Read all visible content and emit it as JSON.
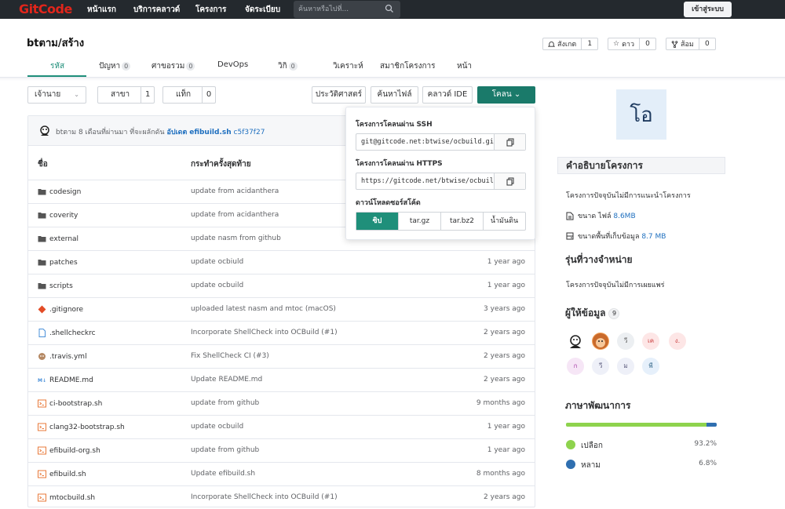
{
  "nav": {
    "logo": "GitCode",
    "items": [
      "หน้าแรก",
      "บริการคลาวด์",
      "โครงการ",
      "จัดระเบียบ"
    ],
    "search_placeholder": "ค้นหาหรือไปที่...",
    "login": "เข้าสู่ระบบ"
  },
  "repo": {
    "title": "btตาม/สร้าง",
    "watch": {
      "label": "สังเกต",
      "count": "1"
    },
    "star": {
      "label": "ดาว",
      "count": "0"
    },
    "fork": {
      "label": "ส้อม",
      "count": "0"
    }
  },
  "tabs": [
    {
      "label": "รหัส",
      "badge": ""
    },
    {
      "label": "ปัญหา",
      "badge": "0"
    },
    {
      "label": "ศาขอรวม",
      "badge": "0"
    },
    {
      "label": "DevOps",
      "badge": ""
    },
    {
      "label": "วิกิ",
      "badge": "0"
    },
    {
      "label": "วิเคราะห์",
      "badge": ""
    },
    {
      "label": "สมาชิกโครงการ",
      "badge": ""
    },
    {
      "label": "หน้า",
      "badge": ""
    }
  ],
  "toolbar": {
    "branch_select": "เจ้านาย",
    "branches": {
      "label": "สาขา",
      "count": "1"
    },
    "tags": {
      "label": "แท็ก",
      "count": "0"
    },
    "history": "ประวัติศาสตร์",
    "find_file": "ค้นหาไฟล์",
    "cloud_ide": "คลาวด์ IDE",
    "clone": "โคลน"
  },
  "commit": {
    "author": "btตาม",
    "when": "8 เดือนที่ผ่านมา",
    "action": "ที่จะผลักดัน",
    "update": "อัปเดต",
    "file": "efibuild.sh",
    "hash": "c5f37f27"
  },
  "table": {
    "col_name": "ชื่อ",
    "col_commit": "กระทำครั้งสุดท้าย",
    "rows": [
      {
        "icon": "folder-icon",
        "name": "codesign",
        "msg": "update from acidanthera",
        "time": ""
      },
      {
        "icon": "folder-icon",
        "name": "coverity",
        "msg": "update from acidanthera",
        "time": ""
      },
      {
        "icon": "folder-icon",
        "name": "external",
        "msg": "update nasm from github",
        "time": ""
      },
      {
        "icon": "folder-icon",
        "name": "patches",
        "msg": "update ocbiuld",
        "time": "1 year ago"
      },
      {
        "icon": "folder-icon",
        "name": "scripts",
        "msg": "update ocbuild",
        "time": "1 year ago"
      },
      {
        "icon": "git-icon",
        "name": ".gitignore",
        "msg": "uploaded latest nasm and mtoc (macOS)",
        "time": "3 years ago"
      },
      {
        "icon": "file-icon",
        "name": ".shellcheckrc",
        "msg": "Incorporate ShellCheck into OCBuild (#1)",
        "time": "2 years ago"
      },
      {
        "icon": "travis-icon",
        "name": ".travis.yml",
        "msg": "Fix ShellCheck CI (#3)",
        "time": "2 years ago"
      },
      {
        "icon": "markdown-icon",
        "name": "README.md",
        "msg": "Update README.md",
        "time": "2 years ago"
      },
      {
        "icon": "shell-icon",
        "name": "ci-bootstrap.sh",
        "msg": "update from github",
        "time": "9 months ago"
      },
      {
        "icon": "shell-icon",
        "name": "clang32-bootstrap.sh",
        "msg": "update ocbuild",
        "time": "1 year ago"
      },
      {
        "icon": "shell-icon",
        "name": "efibuild-org.sh",
        "msg": "update from github",
        "time": "1 year ago"
      },
      {
        "icon": "shell-icon",
        "name": "efibuild.sh",
        "msg": "Update efibuild.sh",
        "time": "8 months ago"
      },
      {
        "icon": "shell-icon",
        "name": "mtocbuild.sh",
        "msg": "Incorporate ShellCheck into OCBuild (#1)",
        "time": "2 years ago"
      }
    ]
  },
  "clone_popover": {
    "ssh_title": "โครงการโคลนผ่าน SSH",
    "ssh_url": "git@gitcode.net:btwise/ocbuild.git",
    "https_title": "โครงการโคลนผ่าน HTTPS",
    "https_url": "https://gitcode.net/btwise/ocbuild.git",
    "download_title": "ดาวน์โหลดซอร์สโค้ด",
    "downloads": [
      "ซิป",
      "tar.gz",
      "tar.bz2",
      "น้ำมันดิน"
    ]
  },
  "sidebar": {
    "avatar_letter": "โอ",
    "desc_title": "คำอธิบายโครงการ",
    "desc_text": "โครงการปัจจุบันไม่มีการแนะนำโครงการ",
    "file_size_label": "ขนาด ไฟล์",
    "file_size": "8.6MB",
    "storage_label": "ขนาดพื้นที่เก็บข้อมูล",
    "storage": "8.7 MB",
    "release_title": "รุ่นที่วางจำหน่าย",
    "release_text": "โครงการปัจจุบันไม่มีการเผยแพร่",
    "contrib_title": "ผู้ให้ข้อมูล",
    "contrib_count": "9",
    "contributors": [
      "",
      "",
      "วี",
      "เค",
      "ง.",
      "ก",
      "วี",
      "ม",
      "พี"
    ],
    "lang_title": "ภาษาพัฒนาการ",
    "languages": [
      {
        "name": "เปลือก",
        "pct": "93.2%",
        "color": "#8ed34d",
        "value": 93.2
      },
      {
        "name": "หลาม",
        "pct": "6.8%",
        "color": "#2f6fb0",
        "value": 6.8
      }
    ]
  }
}
